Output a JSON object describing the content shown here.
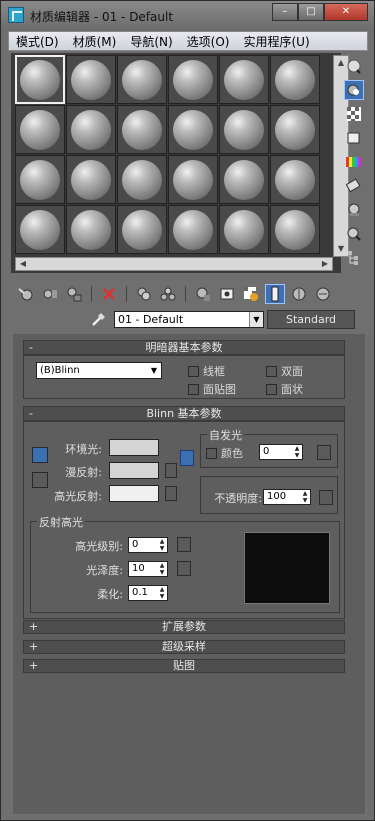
{
  "window": {
    "title": "材质编辑器 - 01 - Default",
    "buttons": [
      "–",
      "□",
      "✕"
    ]
  },
  "menubar": [
    "模式(D)",
    "材质(M)",
    "导航(N)",
    "选项(O)",
    "实用程序(U)"
  ],
  "slots": {
    "count": 24,
    "active_index": 0
  },
  "material": {
    "name": "01 - Default",
    "type": "Standard"
  },
  "shader_basic": {
    "header": "明暗器基本参数",
    "shader": "(B)Blinn",
    "options": [
      "线框",
      "双面",
      "面贴图",
      "面状"
    ]
  },
  "blinn_basic": {
    "header": "Blinn 基本参数",
    "ambient_label": "环境光:",
    "diffuse_label": "漫反射:",
    "specular_label": "高光反射:",
    "self_illum": {
      "title": "自发光",
      "color_label": "颜色",
      "value": "0"
    },
    "opacity": {
      "label": "不透明度:",
      "value": "100"
    },
    "spec_highlights": {
      "title": "反射高光",
      "level_label": "高光级别:",
      "level_value": "0",
      "gloss_label": "光泽度:",
      "gloss_value": "10",
      "soften_label": "柔化:",
      "soften_value": "0.1"
    }
  },
  "rollouts_collapsed": [
    "扩展参数",
    "超级采样",
    "贴图"
  ],
  "colors": {
    "selected_blue": "#3d6fb3",
    "panel": "#5e5e5e"
  },
  "icons": {
    "right_toolbar": [
      "sample-type-icon",
      "backlight-icon",
      "background-icon",
      "uv-tiling-icon",
      "video-color-check-icon",
      "make-preview-icon",
      "options-icon",
      "select-by-material-icon",
      "material-navigator-icon"
    ],
    "bottom_toolbar": [
      "get-material-icon",
      "put-to-scene-icon",
      "assign-to-selection-icon",
      "reset-map-icon",
      "copy-material-icon",
      "make-unique-icon",
      "put-to-library-icon",
      "material-id-channel-icon",
      "show-shaded-in-viewport-icon",
      "show-end-result-icon",
      "go-to-parent-icon",
      "go-forward-to-sibling-icon"
    ]
  }
}
